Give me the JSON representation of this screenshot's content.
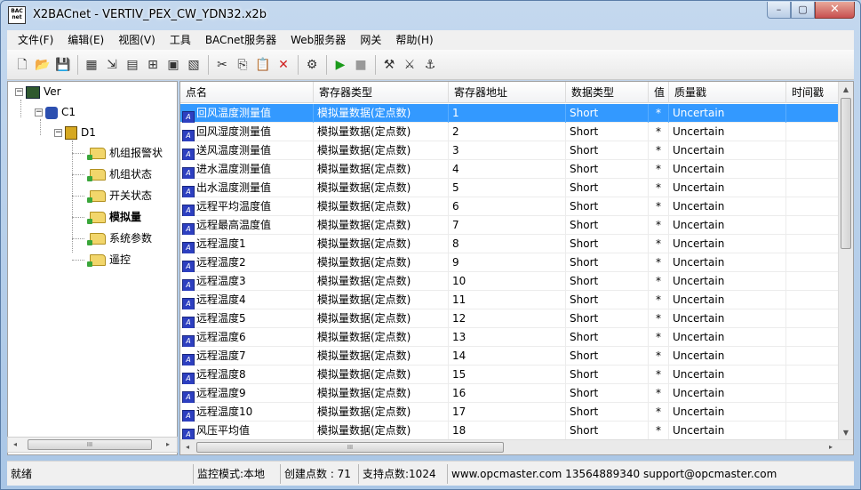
{
  "window": {
    "icon_text": "BAC\nnet",
    "title": "X2BACnet - VERTIV_PEX_CW_YDN32.x2b",
    "buttons": {
      "minimize": "–",
      "maximize": "▢",
      "close": "✕"
    }
  },
  "menu": [
    "文件(F)",
    "编辑(E)",
    "视图(V)",
    "工具",
    "BACnet服务器",
    "Web服务器",
    "网关",
    "帮助(H)"
  ],
  "toolbar_icons": [
    {
      "name": "new-icon",
      "glyph": "🗋"
    },
    {
      "name": "open-icon",
      "glyph": "📂"
    },
    {
      "name": "save-icon",
      "glyph": "💾"
    },
    {
      "sep": true
    },
    {
      "name": "add-channel-icon",
      "glyph": "▦"
    },
    {
      "name": "add-device-icon",
      "glyph": "⇲"
    },
    {
      "name": "add-group-icon",
      "glyph": "▤"
    },
    {
      "name": "add-tag-icon",
      "glyph": "⊞"
    },
    {
      "name": "batch-icon",
      "glyph": "▣"
    },
    {
      "name": "properties-icon",
      "glyph": "▧"
    },
    {
      "sep": true
    },
    {
      "name": "cut-icon",
      "glyph": "✂"
    },
    {
      "name": "copy-icon",
      "glyph": "⎘"
    },
    {
      "name": "paste-icon",
      "glyph": "📋"
    },
    {
      "name": "delete-icon",
      "glyph": "✕"
    },
    {
      "sep": true
    },
    {
      "name": "monitor-icon",
      "glyph": "⚙"
    },
    {
      "sep": true
    },
    {
      "name": "run-icon",
      "glyph": "▶"
    },
    {
      "name": "stop-icon",
      "glyph": "■"
    },
    {
      "sep": true
    },
    {
      "name": "tool1-icon",
      "glyph": "⚒"
    },
    {
      "name": "tool2-icon",
      "glyph": "⚔"
    },
    {
      "name": "tool3-icon",
      "glyph": "⚓"
    }
  ],
  "tree": {
    "root": "Ver",
    "channel": "C1",
    "device": "D1",
    "groups": [
      "机组报警状",
      "机组状态",
      "开关状态",
      "模拟量",
      "系统参数",
      "遥控"
    ],
    "selected_group": "模拟量",
    "expand_minus": "−"
  },
  "grid": {
    "columns": [
      "点名",
      "寄存器类型",
      "寄存器地址",
      "数据类型",
      "值",
      "质量戳",
      "时间戳"
    ],
    "rows": [
      {
        "name": "回风温度测量值",
        "reg_type": "模拟量数据(定点数)",
        "addr": "1",
        "dtype": "Short",
        "value": "*",
        "quality": "Uncertain",
        "time": ""
      },
      {
        "name": "回风湿度测量值",
        "reg_type": "模拟量数据(定点数)",
        "addr": "2",
        "dtype": "Short",
        "value": "*",
        "quality": "Uncertain",
        "time": ""
      },
      {
        "name": "送风温度测量值",
        "reg_type": "模拟量数据(定点数)",
        "addr": "3",
        "dtype": "Short",
        "value": "*",
        "quality": "Uncertain",
        "time": ""
      },
      {
        "name": "进水温度测量值",
        "reg_type": "模拟量数据(定点数)",
        "addr": "4",
        "dtype": "Short",
        "value": "*",
        "quality": "Uncertain",
        "time": ""
      },
      {
        "name": "出水温度测量值",
        "reg_type": "模拟量数据(定点数)",
        "addr": "5",
        "dtype": "Short",
        "value": "*",
        "quality": "Uncertain",
        "time": ""
      },
      {
        "name": "远程平均温度值",
        "reg_type": "模拟量数据(定点数)",
        "addr": "6",
        "dtype": "Short",
        "value": "*",
        "quality": "Uncertain",
        "time": ""
      },
      {
        "name": "远程最高温度值",
        "reg_type": "模拟量数据(定点数)",
        "addr": "7",
        "dtype": "Short",
        "value": "*",
        "quality": "Uncertain",
        "time": ""
      },
      {
        "name": "远程温度1",
        "reg_type": "模拟量数据(定点数)",
        "addr": "8",
        "dtype": "Short",
        "value": "*",
        "quality": "Uncertain",
        "time": ""
      },
      {
        "name": "远程温度2",
        "reg_type": "模拟量数据(定点数)",
        "addr": "9",
        "dtype": "Short",
        "value": "*",
        "quality": "Uncertain",
        "time": ""
      },
      {
        "name": "远程温度3",
        "reg_type": "模拟量数据(定点数)",
        "addr": "10",
        "dtype": "Short",
        "value": "*",
        "quality": "Uncertain",
        "time": ""
      },
      {
        "name": "远程温度4",
        "reg_type": "模拟量数据(定点数)",
        "addr": "11",
        "dtype": "Short",
        "value": "*",
        "quality": "Uncertain",
        "time": ""
      },
      {
        "name": "远程温度5",
        "reg_type": "模拟量数据(定点数)",
        "addr": "12",
        "dtype": "Short",
        "value": "*",
        "quality": "Uncertain",
        "time": ""
      },
      {
        "name": "远程温度6",
        "reg_type": "模拟量数据(定点数)",
        "addr": "13",
        "dtype": "Short",
        "value": "*",
        "quality": "Uncertain",
        "time": ""
      },
      {
        "name": "远程温度7",
        "reg_type": "模拟量数据(定点数)",
        "addr": "14",
        "dtype": "Short",
        "value": "*",
        "quality": "Uncertain",
        "time": ""
      },
      {
        "name": "远程温度8",
        "reg_type": "模拟量数据(定点数)",
        "addr": "15",
        "dtype": "Short",
        "value": "*",
        "quality": "Uncertain",
        "time": ""
      },
      {
        "name": "远程温度9",
        "reg_type": "模拟量数据(定点数)",
        "addr": "16",
        "dtype": "Short",
        "value": "*",
        "quality": "Uncertain",
        "time": ""
      },
      {
        "name": "远程温度10",
        "reg_type": "模拟量数据(定点数)",
        "addr": "17",
        "dtype": "Short",
        "value": "*",
        "quality": "Uncertain",
        "time": ""
      },
      {
        "name": "风压平均值",
        "reg_type": "模拟量数据(定点数)",
        "addr": "18",
        "dtype": "Short",
        "value": "*",
        "quality": "Uncertain",
        "time": ""
      }
    ]
  },
  "scroll": {
    "thumb_grip": "III",
    "up": "▲",
    "down": "▼",
    "left": "◂",
    "right": "▸"
  },
  "status": {
    "ready": "就绪",
    "mode": "监控模式:本地",
    "created": "创建点数 : 71",
    "supported": "支持点数:1024",
    "contact": "www.opcmaster.com 13564889340 support@opcmaster.com"
  },
  "colors": {
    "selection": "#3399ff",
    "title_bar": "#b9d1ea",
    "close_button": "#c75050"
  }
}
